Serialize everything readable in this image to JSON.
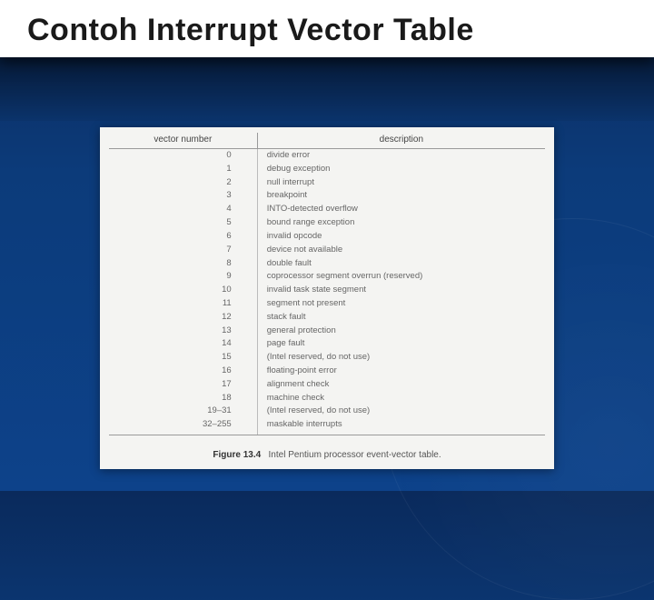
{
  "slide": {
    "title": "Contoh Interrupt Vector Table"
  },
  "table": {
    "header_vector": "vector number",
    "header_desc": "description",
    "rows": [
      {
        "vn": "0",
        "desc": "divide error"
      },
      {
        "vn": "1",
        "desc": "debug exception"
      },
      {
        "vn": "2",
        "desc": "null interrupt"
      },
      {
        "vn": "3",
        "desc": "breakpoint"
      },
      {
        "vn": "4",
        "desc": "INTO-detected overflow"
      },
      {
        "vn": "5",
        "desc": "bound range exception"
      },
      {
        "vn": "6",
        "desc": "invalid opcode"
      },
      {
        "vn": "7",
        "desc": "device not available"
      },
      {
        "vn": "8",
        "desc": "double fault"
      },
      {
        "vn": "9",
        "desc": "coprocessor segment overrun (reserved)"
      },
      {
        "vn": "10",
        "desc": "invalid task state segment"
      },
      {
        "vn": "11",
        "desc": "segment not present"
      },
      {
        "vn": "12",
        "desc": "stack fault"
      },
      {
        "vn": "13",
        "desc": "general protection"
      },
      {
        "vn": "14",
        "desc": "page fault"
      },
      {
        "vn": "15",
        "desc": "(Intel reserved, do not use)"
      },
      {
        "vn": "16",
        "desc": "floating-point error"
      },
      {
        "vn": "17",
        "desc": "alignment check"
      },
      {
        "vn": "18",
        "desc": "machine check"
      },
      {
        "vn": "19–31",
        "desc": "(Intel reserved, do not use)"
      },
      {
        "vn": "32–255",
        "desc": "maskable interrupts"
      }
    ]
  },
  "caption": {
    "label": "Figure 13.4",
    "text": "Intel Pentium processor event-vector table."
  }
}
